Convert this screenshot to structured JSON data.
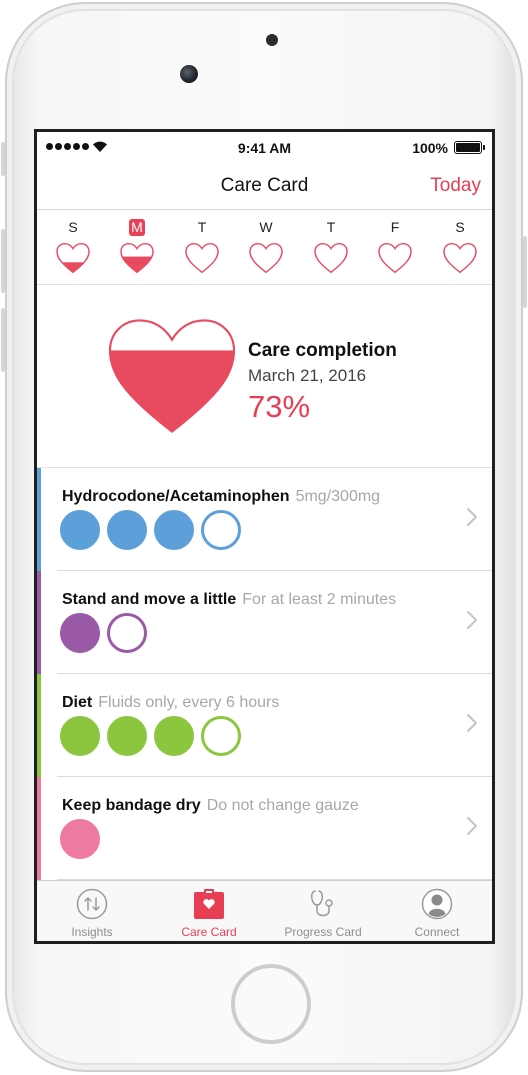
{
  "status_bar": {
    "time": "9:41 AM",
    "battery": "100%"
  },
  "nav": {
    "title": "Care Card",
    "today_button": "Today"
  },
  "week": {
    "days": [
      {
        "letter": "S",
        "fill": 0.35,
        "selected": false
      },
      {
        "letter": "M",
        "fill": 0.55,
        "selected": true
      },
      {
        "letter": "T",
        "fill": 0,
        "selected": false
      },
      {
        "letter": "W",
        "fill": 0,
        "selected": false
      },
      {
        "letter": "T",
        "fill": 0,
        "selected": false
      },
      {
        "letter": "F",
        "fill": 0,
        "selected": false
      },
      {
        "letter": "S",
        "fill": 0,
        "selected": false
      }
    ]
  },
  "summary": {
    "title": "Care completion",
    "date": "March 21, 2016",
    "percent": "73%",
    "fill": 0.73
  },
  "tasks": [
    {
      "title": "Hydrocodone/Acetaminophen",
      "detail": "5mg/300mg",
      "color": "#5d9fd8",
      "completed": 3,
      "total": 4
    },
    {
      "title": "Stand and move a little",
      "detail": "For at least 2 minutes",
      "color": "#9a5aa8",
      "completed": 1,
      "total": 2
    },
    {
      "title": "Diet",
      "detail": "Fluids only, every 6 hours",
      "color": "#8cc63f",
      "completed": 3,
      "total": 4
    },
    {
      "title": "Keep bandage dry",
      "detail": "Do not change gauze",
      "color": "#ef7aa0",
      "completed": 1,
      "total": 1
    }
  ],
  "tab_bar": {
    "tabs": [
      {
        "label": "Insights",
        "icon": "insights-icon",
        "active": false
      },
      {
        "label": "Care Card",
        "icon": "care-card-icon",
        "active": true
      },
      {
        "label": "Progress Card",
        "icon": "stethoscope-icon",
        "active": false
      },
      {
        "label": "Connect",
        "icon": "connect-icon",
        "active": false
      }
    ]
  },
  "colors": {
    "accent": "#e83e54",
    "heart_fill": "#e84a5f"
  }
}
